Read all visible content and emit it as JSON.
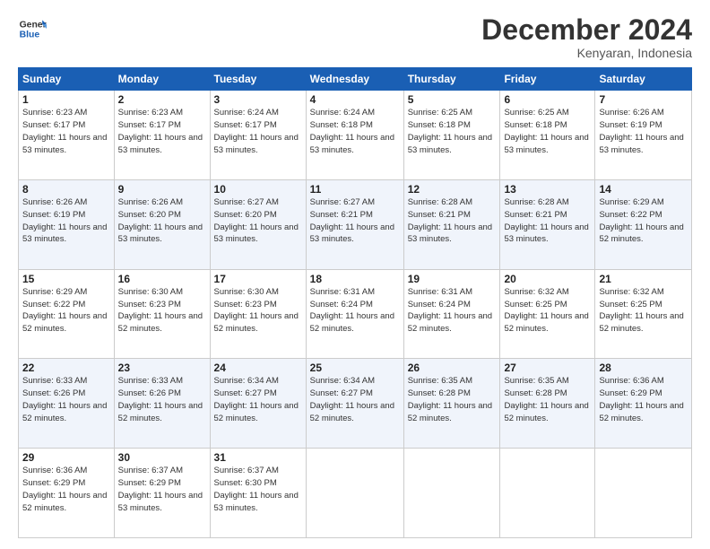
{
  "logo": {
    "line1": "General",
    "line2": "Blue"
  },
  "title": "December 2024",
  "subtitle": "Kenyaran, Indonesia",
  "header_days": [
    "Sunday",
    "Monday",
    "Tuesday",
    "Wednesday",
    "Thursday",
    "Friday",
    "Saturday"
  ],
  "weeks": [
    [
      {
        "num": "1",
        "sunrise": "6:23 AM",
        "sunset": "6:17 PM",
        "daylight": "11 hours and 53 minutes."
      },
      {
        "num": "2",
        "sunrise": "6:23 AM",
        "sunset": "6:17 PM",
        "daylight": "11 hours and 53 minutes."
      },
      {
        "num": "3",
        "sunrise": "6:24 AM",
        "sunset": "6:17 PM",
        "daylight": "11 hours and 53 minutes."
      },
      {
        "num": "4",
        "sunrise": "6:24 AM",
        "sunset": "6:18 PM",
        "daylight": "11 hours and 53 minutes."
      },
      {
        "num": "5",
        "sunrise": "6:25 AM",
        "sunset": "6:18 PM",
        "daylight": "11 hours and 53 minutes."
      },
      {
        "num": "6",
        "sunrise": "6:25 AM",
        "sunset": "6:18 PM",
        "daylight": "11 hours and 53 minutes."
      },
      {
        "num": "7",
        "sunrise": "6:26 AM",
        "sunset": "6:19 PM",
        "daylight": "11 hours and 53 minutes."
      }
    ],
    [
      {
        "num": "8",
        "sunrise": "6:26 AM",
        "sunset": "6:19 PM",
        "daylight": "11 hours and 53 minutes."
      },
      {
        "num": "9",
        "sunrise": "6:26 AM",
        "sunset": "6:20 PM",
        "daylight": "11 hours and 53 minutes."
      },
      {
        "num": "10",
        "sunrise": "6:27 AM",
        "sunset": "6:20 PM",
        "daylight": "11 hours and 53 minutes."
      },
      {
        "num": "11",
        "sunrise": "6:27 AM",
        "sunset": "6:21 PM",
        "daylight": "11 hours and 53 minutes."
      },
      {
        "num": "12",
        "sunrise": "6:28 AM",
        "sunset": "6:21 PM",
        "daylight": "11 hours and 53 minutes."
      },
      {
        "num": "13",
        "sunrise": "6:28 AM",
        "sunset": "6:21 PM",
        "daylight": "11 hours and 53 minutes."
      },
      {
        "num": "14",
        "sunrise": "6:29 AM",
        "sunset": "6:22 PM",
        "daylight": "11 hours and 52 minutes."
      }
    ],
    [
      {
        "num": "15",
        "sunrise": "6:29 AM",
        "sunset": "6:22 PM",
        "daylight": "11 hours and 52 minutes."
      },
      {
        "num": "16",
        "sunrise": "6:30 AM",
        "sunset": "6:23 PM",
        "daylight": "11 hours and 52 minutes."
      },
      {
        "num": "17",
        "sunrise": "6:30 AM",
        "sunset": "6:23 PM",
        "daylight": "11 hours and 52 minutes."
      },
      {
        "num": "18",
        "sunrise": "6:31 AM",
        "sunset": "6:24 PM",
        "daylight": "11 hours and 52 minutes."
      },
      {
        "num": "19",
        "sunrise": "6:31 AM",
        "sunset": "6:24 PM",
        "daylight": "11 hours and 52 minutes."
      },
      {
        "num": "20",
        "sunrise": "6:32 AM",
        "sunset": "6:25 PM",
        "daylight": "11 hours and 52 minutes."
      },
      {
        "num": "21",
        "sunrise": "6:32 AM",
        "sunset": "6:25 PM",
        "daylight": "11 hours and 52 minutes."
      }
    ],
    [
      {
        "num": "22",
        "sunrise": "6:33 AM",
        "sunset": "6:26 PM",
        "daylight": "11 hours and 52 minutes."
      },
      {
        "num": "23",
        "sunrise": "6:33 AM",
        "sunset": "6:26 PM",
        "daylight": "11 hours and 52 minutes."
      },
      {
        "num": "24",
        "sunrise": "6:34 AM",
        "sunset": "6:27 PM",
        "daylight": "11 hours and 52 minutes."
      },
      {
        "num": "25",
        "sunrise": "6:34 AM",
        "sunset": "6:27 PM",
        "daylight": "11 hours and 52 minutes."
      },
      {
        "num": "26",
        "sunrise": "6:35 AM",
        "sunset": "6:28 PM",
        "daylight": "11 hours and 52 minutes."
      },
      {
        "num": "27",
        "sunrise": "6:35 AM",
        "sunset": "6:28 PM",
        "daylight": "11 hours and 52 minutes."
      },
      {
        "num": "28",
        "sunrise": "6:36 AM",
        "sunset": "6:29 PM",
        "daylight": "11 hours and 52 minutes."
      }
    ],
    [
      {
        "num": "29",
        "sunrise": "6:36 AM",
        "sunset": "6:29 PM",
        "daylight": "11 hours and 52 minutes."
      },
      {
        "num": "30",
        "sunrise": "6:37 AM",
        "sunset": "6:29 PM",
        "daylight": "11 hours and 53 minutes."
      },
      {
        "num": "31",
        "sunrise": "6:37 AM",
        "sunset": "6:30 PM",
        "daylight": "11 hours and 53 minutes."
      },
      null,
      null,
      null,
      null
    ]
  ]
}
